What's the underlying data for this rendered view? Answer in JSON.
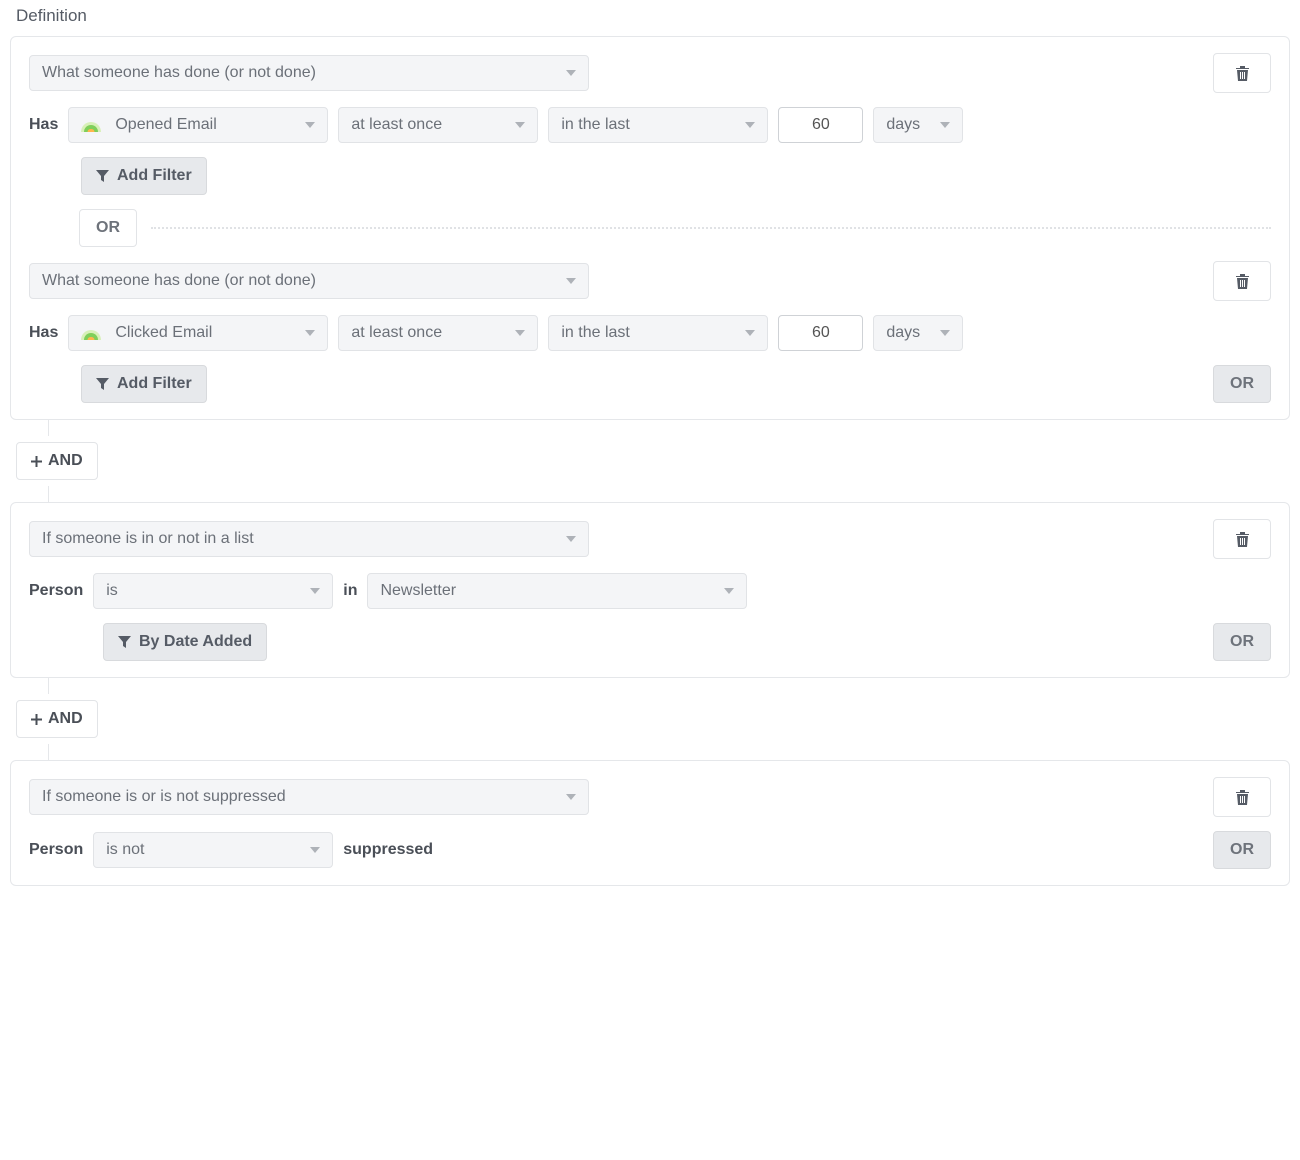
{
  "heading": "Definition",
  "labels": {
    "has": "Has",
    "person": "Person",
    "in": "in",
    "suppressed": "suppressed",
    "or": "OR",
    "and": "AND",
    "addFilter": "Add Filter",
    "byDateAdded": "By Date Added"
  },
  "group1": {
    "cond1": {
      "type": "What someone has done (or not done)",
      "event": "Opened Email",
      "freq": "at least once",
      "range": "in the last",
      "value": "60",
      "unit": "days"
    },
    "cond2": {
      "type": "What someone has done (or not done)",
      "event": "Clicked Email",
      "freq": "at least once",
      "range": "in the last",
      "value": "60",
      "unit": "days"
    }
  },
  "group2": {
    "cond": {
      "type": "If someone is in or not in a list",
      "op": "is",
      "list": "Newsletter"
    }
  },
  "group3": {
    "cond": {
      "type": "If someone is or is not suppressed",
      "op": "is not"
    }
  }
}
